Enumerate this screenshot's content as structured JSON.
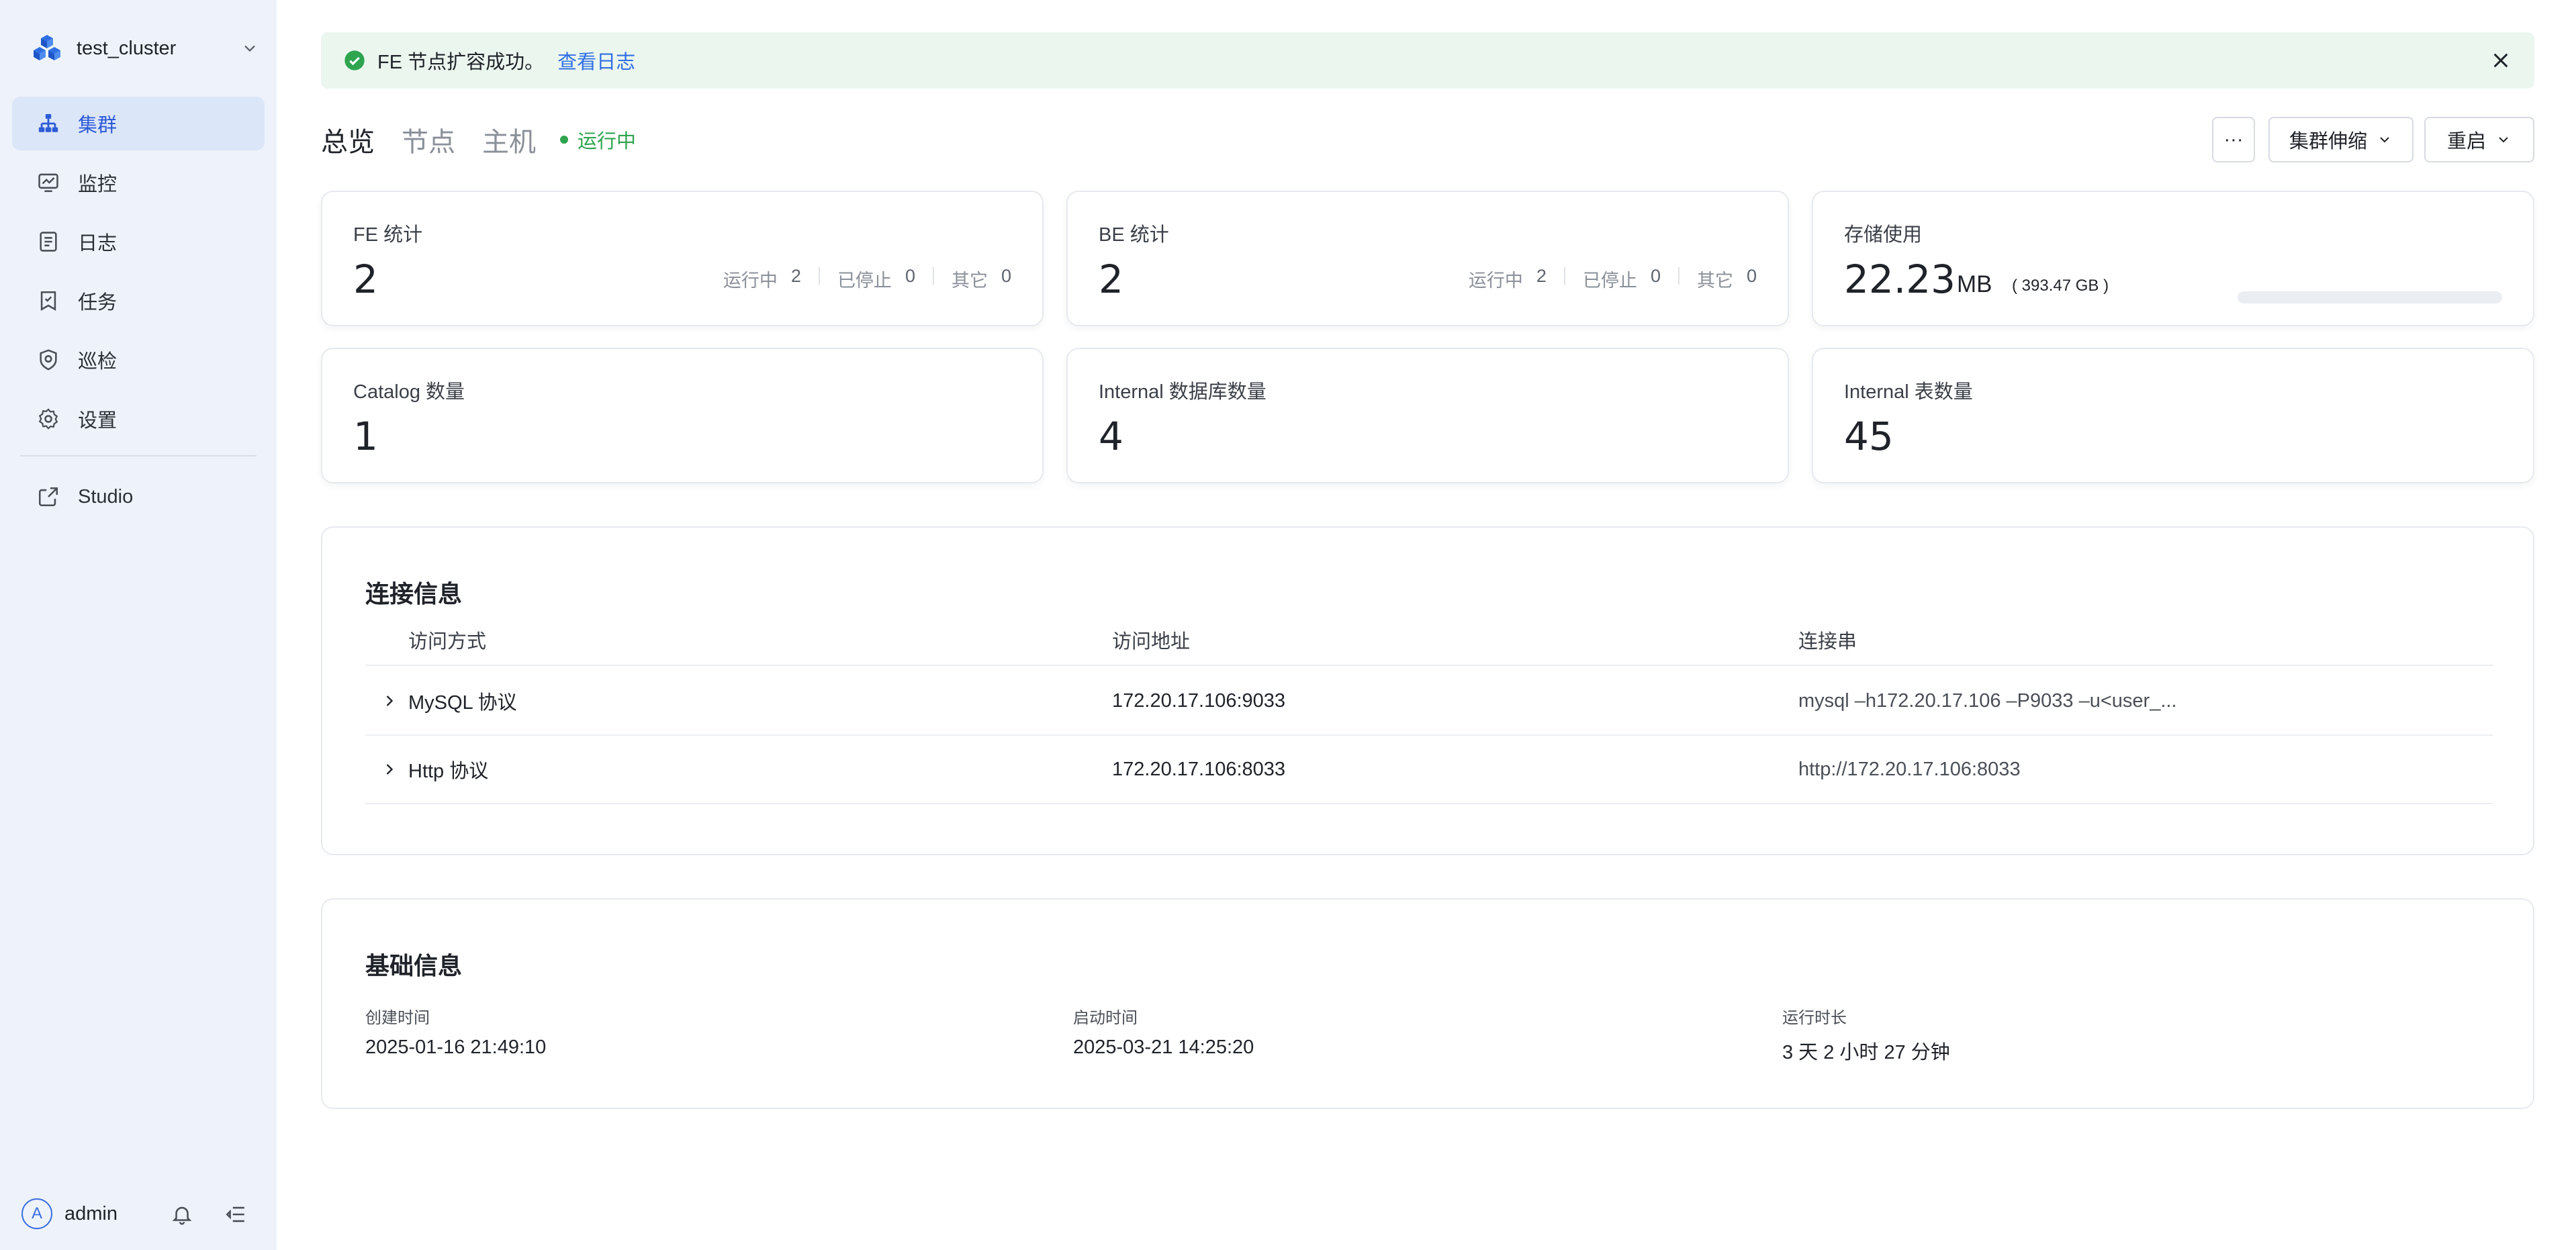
{
  "sidebar": {
    "cluster_name": "test_cluster",
    "nav": [
      {
        "label": "集群",
        "icon": "cluster-icon",
        "active": true
      },
      {
        "label": "监控",
        "icon": "monitor-icon",
        "active": false
      },
      {
        "label": "日志",
        "icon": "log-icon",
        "active": false
      },
      {
        "label": "任务",
        "icon": "task-icon",
        "active": false
      },
      {
        "label": "巡检",
        "icon": "inspection-icon",
        "active": false
      },
      {
        "label": "设置",
        "icon": "settings-icon",
        "active": false
      }
    ],
    "studio_label": "Studio",
    "user": {
      "avatar_letter": "A",
      "name": "admin"
    }
  },
  "alert": {
    "message": "FE 节点扩容成功。",
    "link": "查看日志"
  },
  "tabs": [
    {
      "label": "总览",
      "active": true
    },
    {
      "label": "节点",
      "active": false
    },
    {
      "label": "主机",
      "active": false
    }
  ],
  "status": "运行中",
  "actions": {
    "more": "···",
    "scale": "集群伸缩",
    "restart": "重启"
  },
  "stats": {
    "fe": {
      "label": "FE 统计",
      "value": "2",
      "running_label": "运行中",
      "running": "2",
      "stopped_label": "已停止",
      "stopped": "0",
      "other_label": "其它",
      "other": "0"
    },
    "be": {
      "label": "BE 统计",
      "value": "2",
      "running_label": "运行中",
      "running": "2",
      "stopped_label": "已停止",
      "stopped": "0",
      "other_label": "其它",
      "other": "0"
    },
    "storage": {
      "label": "存储使用",
      "value": "22.23",
      "unit": "MB",
      "total": "( 393.47 GB )",
      "usage_fraction": 0.0001
    },
    "catalog": {
      "label": "Catalog 数量",
      "value": "1"
    },
    "internal_db": {
      "label": "Internal 数据库数量",
      "value": "4"
    },
    "internal_table": {
      "label": "Internal 表数量",
      "value": "45"
    }
  },
  "connection": {
    "title": "连接信息",
    "headers": {
      "method": "访问方式",
      "address": "访问地址",
      "conn_string": "连接串"
    },
    "rows": [
      {
        "method": "MySQL 协议",
        "address": "172.20.17.106:9033",
        "conn_string": "mysql –h172.20.17.106 –P9033 –u<user_..."
      },
      {
        "method": "Http 协议",
        "address": "172.20.17.106:8033",
        "conn_string": "http://172.20.17.106:8033"
      }
    ]
  },
  "basic": {
    "title": "基础信息",
    "created_label": "创建时间",
    "created": "2025-01-16 21:49:10",
    "started_label": "启动时间",
    "started": "2025-03-21 14:25:20",
    "uptime_label": "运行时长",
    "uptime": "3 天 2 小时 27 分钟"
  },
  "colors": {
    "accent": "#2f6fe4",
    "running_green": "#2ea44f",
    "sidebar_bg": "#eef3fb",
    "alert_bg": "#ebf6ee"
  }
}
